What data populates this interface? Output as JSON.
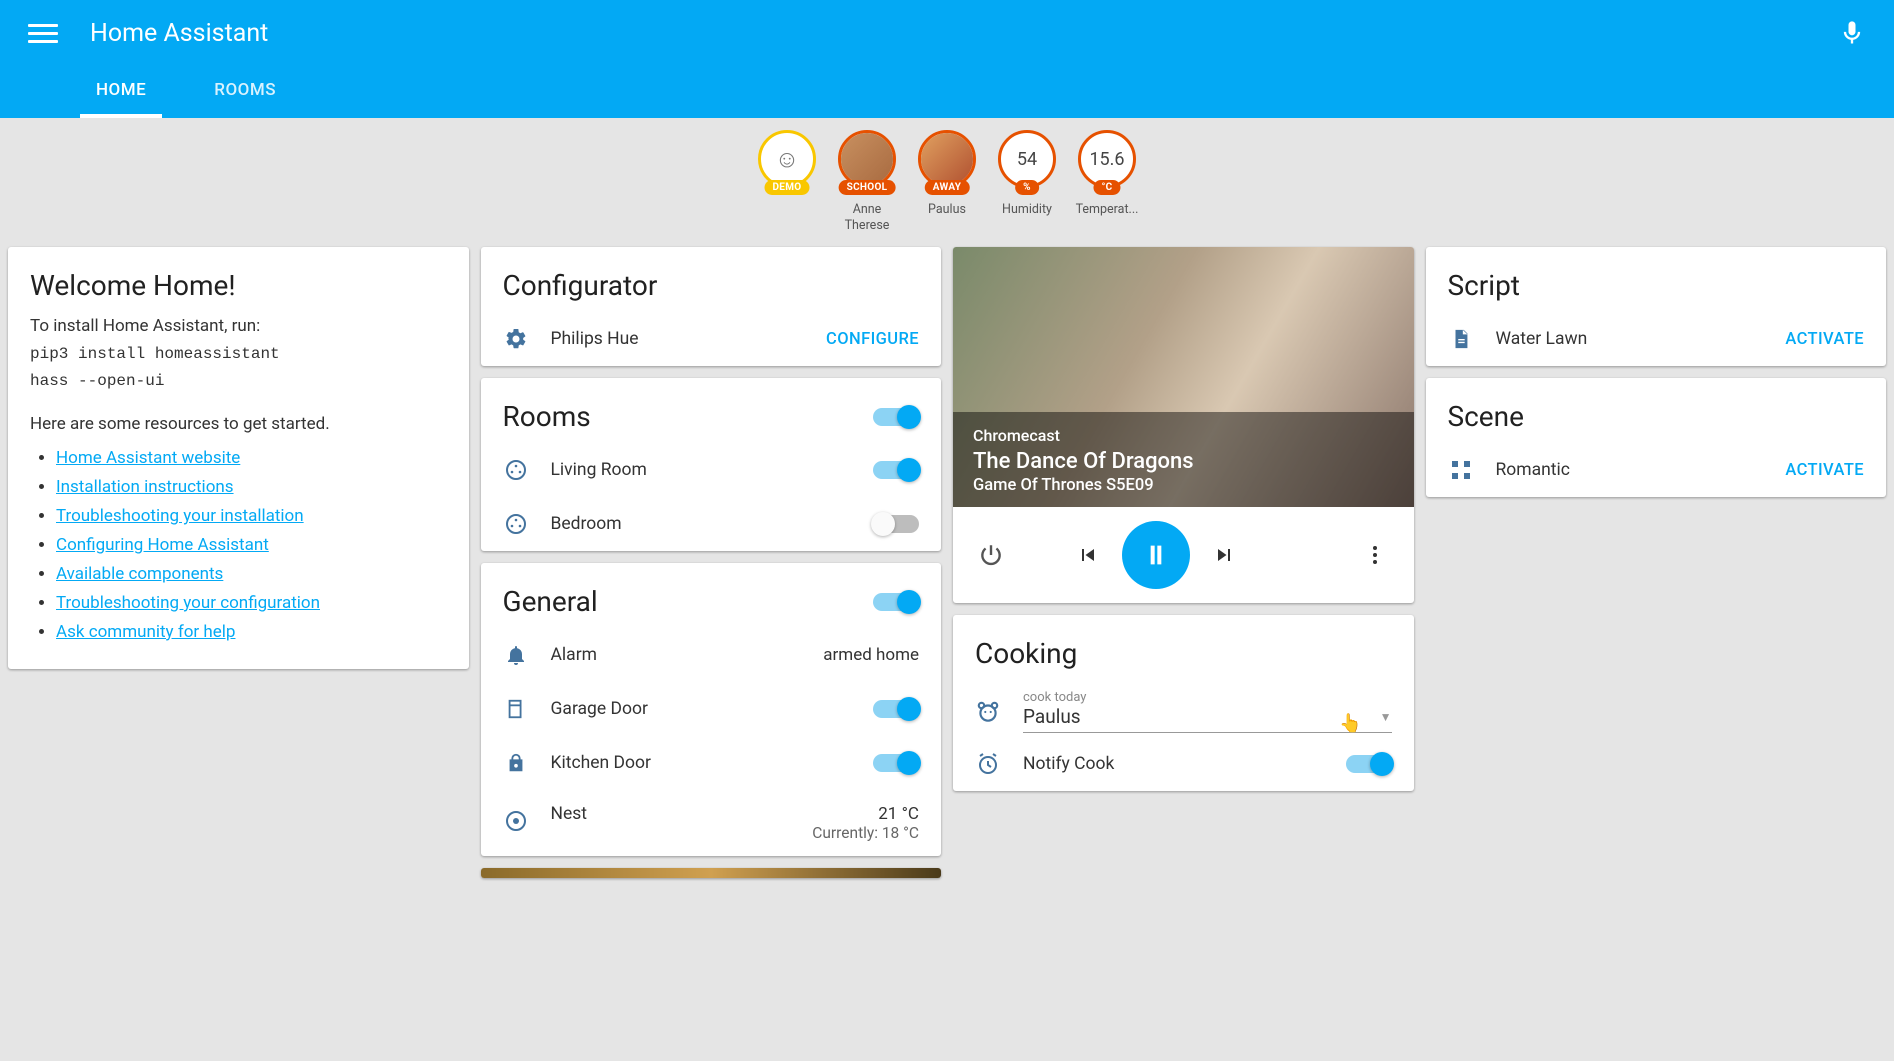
{
  "header": {
    "title": "Home Assistant",
    "tabs": [
      {
        "label": "HOME",
        "active": true
      },
      {
        "label": "ROOMS",
        "active": false
      }
    ]
  },
  "badges": [
    {
      "variant": "smiley",
      "pill": "DEMO",
      "color": "yellow",
      "label": ""
    },
    {
      "variant": "avatar",
      "pill": "SCHOOL",
      "color": "orange",
      "label": "Anne Therese"
    },
    {
      "variant": "avatar",
      "pill": "AWAY",
      "color": "orange",
      "label": "Paulus"
    },
    {
      "variant": "value",
      "value": "54",
      "pill": "%",
      "color": "orange",
      "label": "Humidity"
    },
    {
      "variant": "value",
      "value": "15.6",
      "pill": "°C",
      "color": "orange",
      "label": "Temperat..."
    }
  ],
  "welcome": {
    "title": "Welcome Home!",
    "install_text": "To install Home Assistant, run:",
    "cmd1": "pip3 install homeassistant",
    "cmd2": "hass --open-ui",
    "resources_text": "Here are some resources to get started.",
    "links": [
      "Home Assistant website",
      "Installation instructions",
      "Troubleshooting your installation",
      "Configuring Home Assistant",
      "Available components",
      "Troubleshooting your configuration",
      "Ask community for help"
    ]
  },
  "configurator": {
    "title": "Configurator",
    "item": "Philips Hue",
    "action": "CONFIGURE"
  },
  "rooms": {
    "title": "Rooms",
    "group_on": true,
    "items": [
      {
        "label": "Living Room",
        "on": true
      },
      {
        "label": "Bedroom",
        "on": false
      }
    ]
  },
  "general": {
    "title": "General",
    "group_on": true,
    "items": [
      {
        "icon": "bell",
        "label": "Alarm",
        "status": "armed home",
        "type": "status"
      },
      {
        "icon": "garage",
        "label": "Garage Door",
        "on": true,
        "type": "toggle"
      },
      {
        "icon": "lock",
        "label": "Kitchen Door",
        "on": true,
        "type": "toggle"
      },
      {
        "icon": "thermo",
        "label": "Nest",
        "status": "21 °C",
        "sub": "Currently: 18 °C",
        "type": "thermo"
      }
    ]
  },
  "media": {
    "device": "Chromecast",
    "title": "The Dance Of Dragons",
    "subtitle": "Game Of Thrones S5E09"
  },
  "cooking": {
    "title": "Cooking",
    "select_label": "cook today",
    "select_value": "Paulus",
    "notify_label": "Notify Cook",
    "notify_on": true
  },
  "script": {
    "title": "Script",
    "item": "Water Lawn",
    "action": "ACTIVATE"
  },
  "scene": {
    "title": "Scene",
    "item": "Romantic",
    "action": "ACTIVATE"
  }
}
